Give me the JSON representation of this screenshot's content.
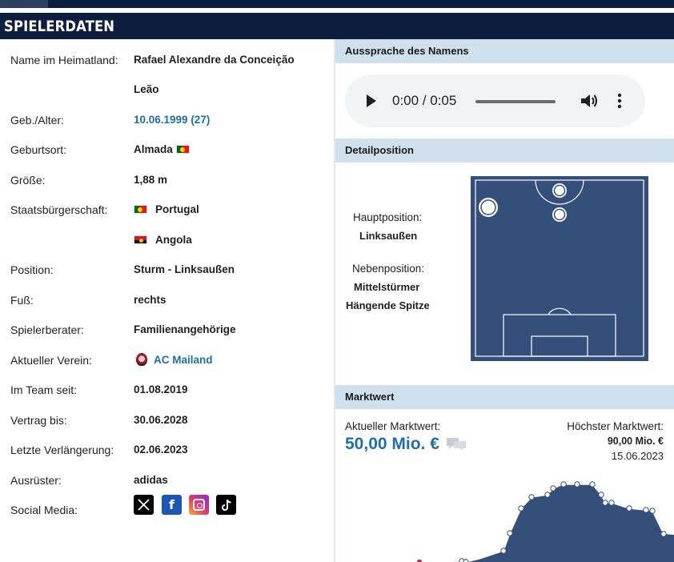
{
  "section_title": "SPIELERDATEN",
  "player": {
    "native_name_label": "Name im Heimatland:",
    "native_name_line1": "Rafael Alexandre da Conceição",
    "native_name_line2": "Leão",
    "dob_label": "Geb./Alter:",
    "dob_value": "10.06.1999 (27)",
    "birthplace_label": "Geburtsort:",
    "birthplace_value": "Almada",
    "height_label": "Größe:",
    "height_value": "1,88 m",
    "citizenship_label": "Staatsbürgerschaft:",
    "citizenship_1": "Portugal",
    "citizenship_2": "Angola",
    "position_label": "Position:",
    "position_value": "Sturm - Linksaußen",
    "foot_label": "Fuß:",
    "foot_value": "rechts",
    "agent_label": "Spielerberater:",
    "agent_value": "Familienangehörige",
    "club_label": "Aktueller Verein:",
    "club_value": "AC Mailand",
    "joined_label": "Im Team seit:",
    "joined_value": "01.08.2019",
    "contract_label": "Vertrag bis:",
    "contract_value": "30.06.2028",
    "extension_label": "Letzte Verlängerung:",
    "extension_value": "02.06.2023",
    "outfitter_label": "Ausrüster:",
    "outfitter_value": "adidas",
    "social_label": "Social Media:",
    "social_icons": [
      "x-icon",
      "facebook-icon",
      "instagram-icon",
      "tiktok-icon"
    ]
  },
  "pronunciation": {
    "title": "Aussprache des Namens",
    "time": "0:00 / 0:05"
  },
  "detail_position": {
    "title": "Detailposition",
    "main_label": "Hauptposition:",
    "main_value": "Linksaußen",
    "secondary_label": "Nebenposition:",
    "secondary_1": "Mittelstürmer",
    "secondary_2": "Hängende Spitze"
  },
  "market_value": {
    "title": "Marktwert",
    "current_label": "Aktueller Marktwert:",
    "current_value": "50,00 Mio. €",
    "highest_label": "Höchster Marktwert:",
    "highest_value": "90,00 Mio. €",
    "highest_date": "15.06.2023"
  },
  "colors": {
    "header_bg": "#0e1e3e",
    "section_head_bg": "#cfe0ec",
    "link": "#1d6fa5",
    "pitch": "#34507a"
  }
}
